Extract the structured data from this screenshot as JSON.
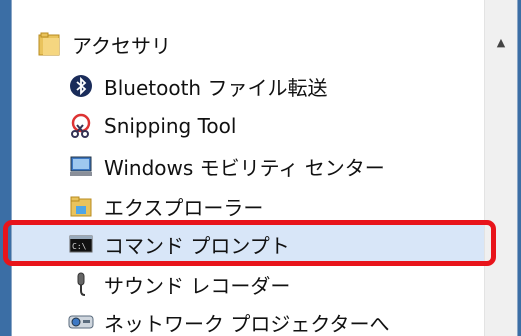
{
  "start_menu": {
    "folder": {
      "label": "アクセサリ",
      "icon": "folder-icon"
    },
    "items": [
      {
        "label": "Bluetooth ファイル転送",
        "icon": "bluetooth-icon"
      },
      {
        "label": "Snipping Tool",
        "icon": "scissors-icon"
      },
      {
        "label": "Windows モビリティ センター",
        "icon": "mobility-center-icon"
      },
      {
        "label": "エクスプローラー",
        "icon": "explorer-folder-icon"
      },
      {
        "label": "コマンド プロンプト",
        "icon": "command-prompt-icon",
        "selected": true
      },
      {
        "label": "サウンド レコーダー",
        "icon": "microphone-icon"
      },
      {
        "label": "ネットワーク プロジェクターへ",
        "icon": "projector-icon"
      }
    ]
  },
  "scrollbar": {
    "up_icon": "scroll-up-arrow-icon"
  },
  "annotation": {
    "color": "#e8141b",
    "target": "コマンド プロンプト"
  },
  "colors": {
    "selected_bg": "#d8e6f8",
    "highlight": "#e8141b"
  }
}
